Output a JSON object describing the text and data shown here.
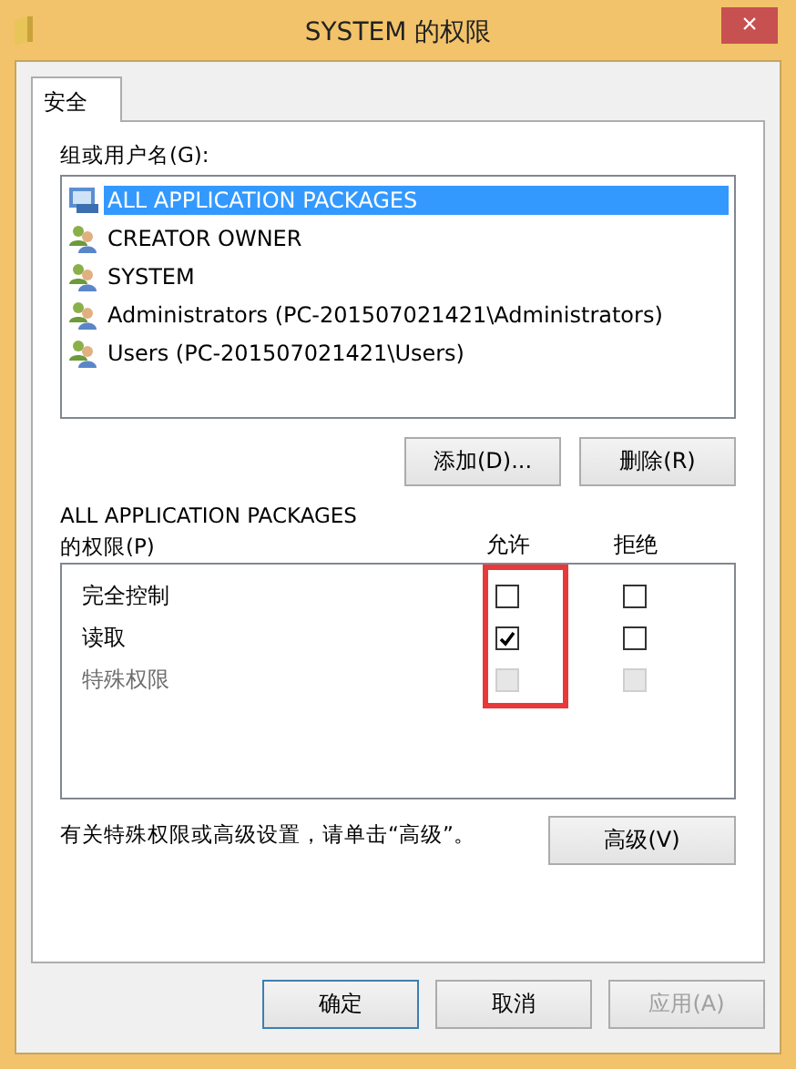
{
  "window": {
    "title": "SYSTEM 的权限",
    "close": "×"
  },
  "tabs": [
    {
      "label": "安全",
      "selected": true
    }
  ],
  "group_list": {
    "label": "组或用户名(G):",
    "items": [
      {
        "name": "ALL APPLICATION PACKAGES",
        "kind": "package",
        "selected": true
      },
      {
        "name": "CREATOR OWNER",
        "kind": "group",
        "selected": false
      },
      {
        "name": "SYSTEM",
        "kind": "group",
        "selected": false
      },
      {
        "name": "Administrators (PC-201507021421\\Administrators)",
        "kind": "group",
        "selected": false
      },
      {
        "name": "Users (PC-201507021421\\Users)",
        "kind": "group",
        "selected": false
      }
    ]
  },
  "list_buttons": [
    {
      "label": "添加(D)..."
    },
    {
      "label": "删除(R)"
    }
  ],
  "permissions": {
    "label_line1": "ALL APPLICATION PACKAGES",
    "label_line2": "的权限(P)",
    "columns": [
      "允许",
      "拒绝"
    ],
    "highlight_allow": true,
    "rows": [
      {
        "name": "完全控制",
        "allow": {
          "checked": false,
          "disabled": false
        },
        "deny": {
          "checked": false,
          "disabled": false
        }
      },
      {
        "name": "读取",
        "allow": {
          "checked": true,
          "disabled": false
        },
        "deny": {
          "checked": false,
          "disabled": false
        }
      },
      {
        "name": "特殊权限",
        "allow": {
          "checked": false,
          "disabled": true
        },
        "deny": {
          "checked": false,
          "disabled": true
        }
      }
    ]
  },
  "advanced": {
    "hint": "有关特殊权限或高级设置，请单击“高级”。",
    "button": "高级(V)"
  },
  "footer_buttons": [
    {
      "label": "确定",
      "default": true,
      "disabled": false
    },
    {
      "label": "取消",
      "default": false,
      "disabled": false
    },
    {
      "label": "应用(A)",
      "default": false,
      "disabled": true
    }
  ]
}
